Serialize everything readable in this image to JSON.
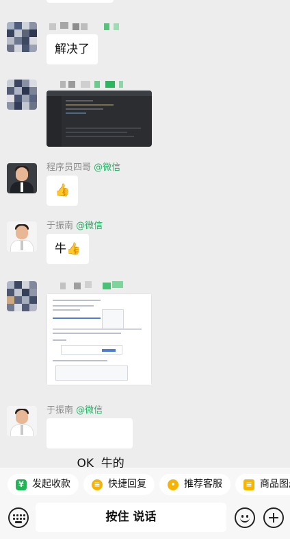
{
  "messages": [
    {
      "sender": "",
      "text": "解决了"
    },
    {
      "sender": "程序员四哥",
      "tag": "@微信",
      "text": "👍"
    },
    {
      "sender": "于振南",
      "tag": "@微信",
      "text": "牛👍"
    },
    {
      "sender": "于振南",
      "tag": "@微信",
      "text": "OK  牛的"
    }
  ],
  "quick_replies": [
    {
      "label": "发起收款",
      "icon": "yen-icon"
    },
    {
      "label": "快捷回复",
      "icon": "quick-reply-icon"
    },
    {
      "label": "推荐客服",
      "icon": "customer-service-icon"
    },
    {
      "label": "商品图册",
      "icon": "catalog-icon"
    }
  ],
  "input": {
    "hold_to_talk": "按住 说话"
  },
  "colors": {
    "tag_green": "#2aae67",
    "background": "#ededed",
    "bubble": "#ffffff"
  }
}
